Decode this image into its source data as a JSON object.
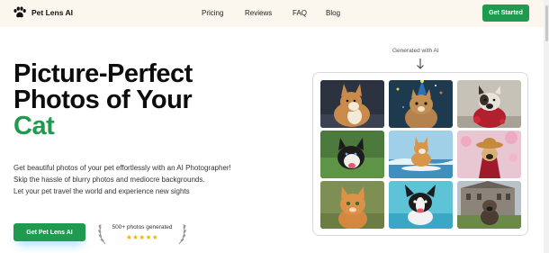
{
  "nav": {
    "brand": "Pet Lens AI",
    "links": [
      "Pricing",
      "Reviews",
      "FAQ",
      "Blog"
    ],
    "cta": "Get Started"
  },
  "hero": {
    "title_line1": "Picture-Perfect",
    "title_line2": "Photos of Your",
    "title_accent": "Cat",
    "subtitle_lines": [
      "Get beautiful photos of your pet effortlessly with an AI Photographer!",
      "Skip the hassle of blurry photos and mediocre backgrounds.",
      "Let your pet travel the world and experience new sights"
    ],
    "cta": "Get Pet Lens AI",
    "badge_text": "500+ photos generated",
    "stars": "★★★★★",
    "rating": 5
  },
  "gallery": {
    "label": "Generated with AI",
    "tiles": [
      "corgi-dog-photo",
      "cat-party-hat-photo",
      "bulldog-rose-sweater-photo",
      "husky-dog-photo",
      "corgi-surfing-photo",
      "pug-kimono-photo",
      "orange-kitten-photo",
      "boston-terrier-pool-photo",
      "pug-mansion-photo"
    ]
  },
  "colors": {
    "accent": "#1f9a4e",
    "nav_bg": "#fbf7ee",
    "star": "#f2b300"
  }
}
